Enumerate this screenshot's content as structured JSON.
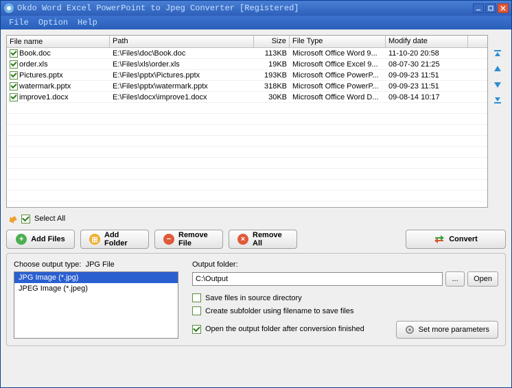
{
  "window": {
    "title": "Okdo Word Excel PowerPoint to Jpeg Converter [Registered]"
  },
  "menu": {
    "file": "File",
    "option": "Option",
    "help": "Help"
  },
  "table": {
    "headers": {
      "name": "File name",
      "path": "Path",
      "size": "Size",
      "type": "File Type",
      "date": "Modify date"
    },
    "rows": [
      {
        "checked": true,
        "name": "Book.doc",
        "path": "E:\\Files\\doc\\Book.doc",
        "size": "113KB",
        "type": "Microsoft Office Word 9...",
        "date": "11-10-20 20:58"
      },
      {
        "checked": true,
        "name": "order.xls",
        "path": "E:\\Files\\xls\\order.xls",
        "size": "19KB",
        "type": "Microsoft Office Excel 9...",
        "date": "08-07-30 21:25"
      },
      {
        "checked": true,
        "name": "Pictures.pptx",
        "path": "E:\\Files\\pptx\\Pictures.pptx",
        "size": "193KB",
        "type": "Microsoft Office PowerP...",
        "date": "09-09-23 11:51"
      },
      {
        "checked": true,
        "name": "watermark.pptx",
        "path": "E:\\Files\\pptx\\watermark.pptx",
        "size": "318KB",
        "type": "Microsoft Office PowerP...",
        "date": "09-09-23 11:51"
      },
      {
        "checked": true,
        "name": "improve1.docx",
        "path": "E:\\Files\\docx\\improve1.docx",
        "size": "30KB",
        "type": "Microsoft Office Word D...",
        "date": "09-08-14 10:17"
      }
    ]
  },
  "select_all": {
    "label": "Select All",
    "checked": true
  },
  "buttons": {
    "add_files": "Add Files",
    "add_folder": "Add Folder",
    "remove_file": "Remove File",
    "remove_all": "Remove All",
    "convert": "Convert"
  },
  "output_type": {
    "label": "Choose output type:",
    "current": "JPG File",
    "items": [
      {
        "label": "JPG Image (*.jpg)",
        "selected": true
      },
      {
        "label": "JPEG Image (*.jpeg)",
        "selected": false
      }
    ]
  },
  "output_folder": {
    "label": "Output folder:",
    "value": "C:\\Output",
    "browse": "...",
    "open": "Open"
  },
  "options": {
    "save_source": {
      "label": "Save files in source directory",
      "checked": false
    },
    "create_subfolder": {
      "label": "Create subfolder using filename to save files",
      "checked": false
    },
    "open_after": {
      "label": "Open the output folder after conversion finished",
      "checked": true
    }
  },
  "more_params": "Set more parameters"
}
